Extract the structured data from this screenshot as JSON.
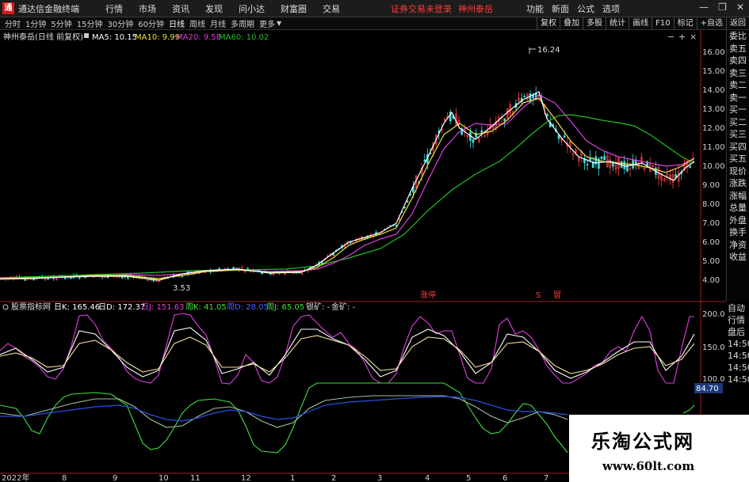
{
  "app": {
    "title": "通达信金融终端",
    "logo": "通",
    "menus": [
      "行情",
      "市场",
      "资讯",
      "发现",
      "问小达",
      "财富圈",
      "交易"
    ],
    "status_login": "证券交易未登录",
    "status_stock": "神州泰岳",
    "right_menus": [
      "功能",
      "新面",
      "公式",
      "选项"
    ],
    "window_controls": [
      "minimize-icon",
      "restore-icon",
      "close-icon"
    ]
  },
  "periods": {
    "items": [
      "分时",
      "1分钟",
      "5分钟",
      "15分钟",
      "30分钟",
      "60分钟",
      "日线",
      "周线",
      "月线",
      "多周期",
      "更多"
    ],
    "active": "日线"
  },
  "toolbar_right": [
    "复权",
    "叠加",
    "多股",
    "统计",
    "画线",
    "F10",
    "标记",
    "+自选",
    "返回"
  ],
  "main_legend": {
    "stock": "神州泰岳(日线 前复权)",
    "ma5": "MA5: 10.15",
    "ma10": "MA10: 9.99",
    "ma20": "MA20: 9.58",
    "ma60": "MA60: 10.02"
  },
  "price_axis": [
    "16.00",
    "15.00",
    "14.00",
    "13.00",
    "12.00",
    "11.00",
    "10.00",
    "9.00",
    "8.00",
    "7.00",
    "6.00",
    "5.00",
    "4.00"
  ],
  "annotations": {
    "high": "16.24",
    "low": "3.53",
    "signal_up": "涨停",
    "signal_mid": "S",
    "signal_red": "冒"
  },
  "indicator_legend": {
    "name": "股票指标网",
    "day_k": "日K: 165.46",
    "day_d": "日D: 172.37",
    "day_j": "日J: 151.63",
    "week_k": "周K: 41.05",
    "week_d": "周D: 28.05",
    "week_j": "周J: 65.05",
    "silver": "银矿: -",
    "gold": "金矿: -"
  },
  "indicator_axis": [
    "200.0",
    "150.0",
    "100.0"
  ],
  "lower_value": "84.70",
  "date_axis": [
    "2022年",
    "8",
    "9",
    "10",
    "11",
    "12",
    "1",
    "2",
    "3",
    "4",
    "5",
    "6",
    "7"
  ],
  "sidebar_tabs": [
    "委比",
    "卖五",
    "卖四",
    "卖三",
    "卖二",
    "卖一",
    "买一",
    "买二",
    "买三",
    "买四",
    "买五",
    "现价",
    "涨跌",
    "涨幅",
    "总量",
    "外盘",
    "换手",
    "净资",
    "收益"
  ],
  "sidebar_lower": [
    "自动",
    "行情",
    "盘后",
    "14:50",
    "14:50",
    "14:50",
    "14:50"
  ],
  "watermark": {
    "cn": "乐淘公式网",
    "url": "www.60lt.com"
  },
  "colors": {
    "ma5": "#ffffff",
    "ma10": "#f0e040",
    "ma20": "#e040e0",
    "ma60": "#20c020",
    "up": "#ff4040",
    "down": "#40e0e0",
    "menu_red": "#ff3a3a"
  }
}
